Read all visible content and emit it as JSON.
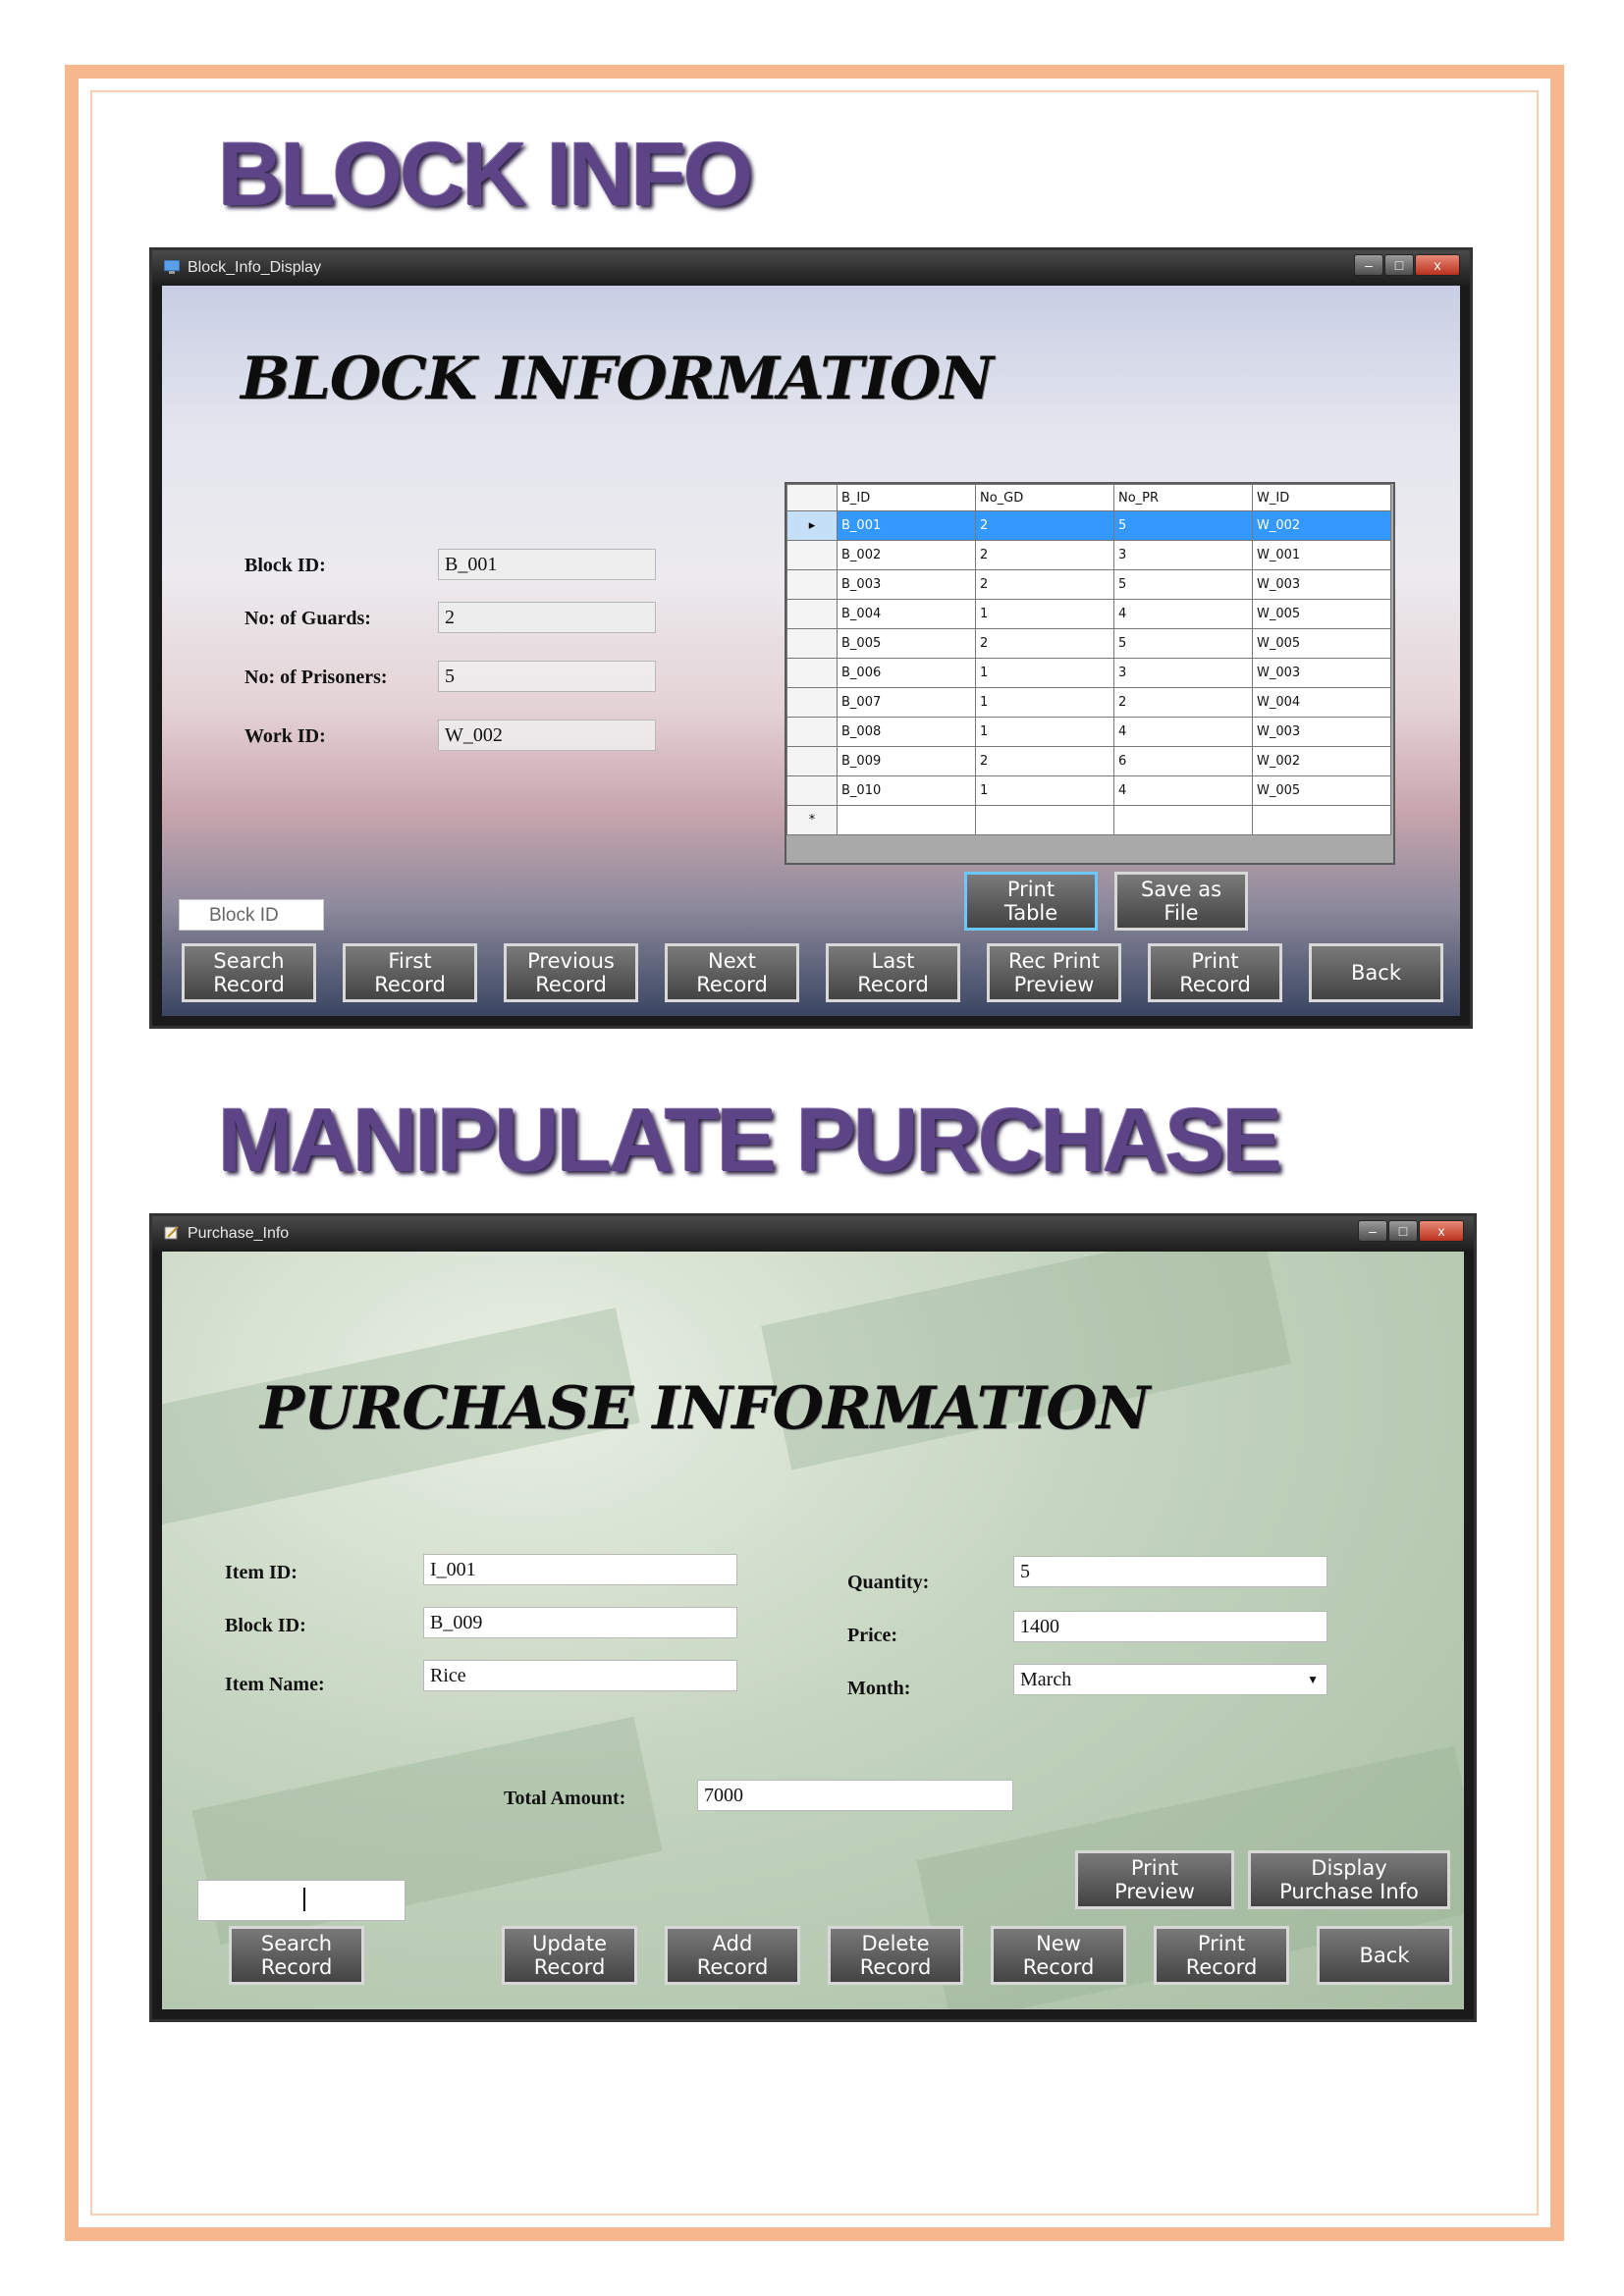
{
  "headings": {
    "block": "BLOCK INFO",
    "purchase": "MANIPULATE PURCHASE"
  },
  "window1": {
    "title": "Block_Info_Display",
    "form_title": "BLOCK INFORMATION",
    "fields": [
      {
        "label": "Block ID:",
        "value": "B_001"
      },
      {
        "label": "No: of Guards:",
        "value": "2"
      },
      {
        "label": "No: of Prisoners:",
        "value": "5"
      },
      {
        "label": "Work ID:",
        "value": "W_002"
      }
    ],
    "grid": {
      "columns": [
        "B_ID",
        "No_GD",
        "No_PR",
        "W_ID"
      ],
      "rows": [
        [
          "B_001",
          "2",
          "5",
          "W_002"
        ],
        [
          "B_002",
          "2",
          "3",
          "W_001"
        ],
        [
          "B_003",
          "2",
          "5",
          "W_003"
        ],
        [
          "B_004",
          "1",
          "4",
          "W_005"
        ],
        [
          "B_005",
          "2",
          "5",
          "W_005"
        ],
        [
          "B_006",
          "1",
          "3",
          "W_003"
        ],
        [
          "B_007",
          "1",
          "2",
          "W_004"
        ],
        [
          "B_008",
          "1",
          "4",
          "W_003"
        ],
        [
          "B_009",
          "2",
          "6",
          "W_002"
        ],
        [
          "B_010",
          "1",
          "4",
          "W_005"
        ]
      ],
      "new_row_marker": "*",
      "current_row_marker": "▸"
    },
    "search_box": "Block ID",
    "buttons": {
      "print_table": "Print\nTable",
      "save_as_file": "Save as\nFile",
      "search": "Search\nRecord",
      "first": "First\nRecord",
      "previous": "Previous\nRecord",
      "next": "Next\nRecord",
      "last": "Last\nRecord",
      "rec_print_preview": "Rec Print\nPreview",
      "print_record": "Print\nRecord",
      "back": "Back"
    }
  },
  "window2": {
    "title": "Purchase_Info",
    "form_title": "PURCHASE INFORMATION",
    "left_fields": [
      {
        "label": "Item ID:",
        "value": "I_001"
      },
      {
        "label": "Block ID:",
        "value": "B_009"
      },
      {
        "label": "Item Name:",
        "value": "Rice"
      }
    ],
    "right_fields": [
      {
        "label": "Quantity:",
        "value": "5"
      },
      {
        "label": "Price:",
        "value": "1400"
      },
      {
        "label": "Month:",
        "value": "March"
      }
    ],
    "total": {
      "label": "Total Amount:",
      "value": "7000"
    },
    "search_input": "",
    "buttons": {
      "print_preview": "Print\nPreview",
      "display_purchase_info": "Display\nPurchase Info",
      "search": "Search\nRecord",
      "update": "Update\nRecord",
      "add": "Add\nRecord",
      "delete": "Delete\nRecord",
      "new": "New\nRecord",
      "print_record": "Print\nRecord",
      "back": "Back"
    }
  },
  "window_controls": {
    "minimize": "–",
    "maximize": "□",
    "close": "x"
  },
  "colors": {
    "page_border": "#f5b88d",
    "heading": "#5d4486",
    "grid_selection": "#3399ff",
    "button_bg": "#5a5a5a"
  }
}
